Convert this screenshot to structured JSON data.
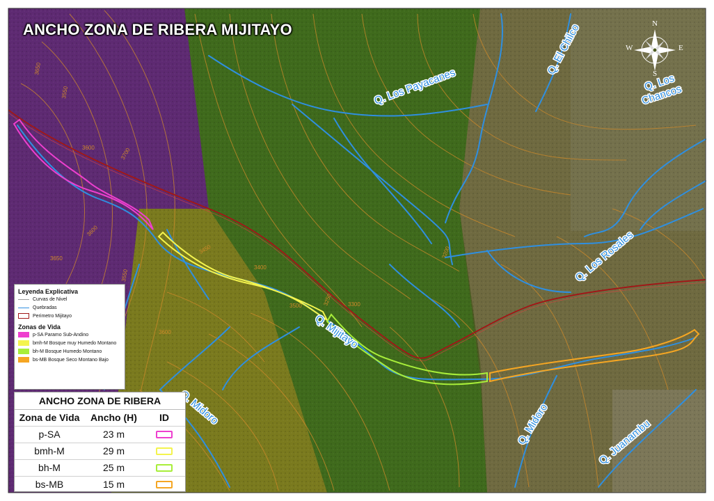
{
  "title": "ANCHO ZONA DE RIBERA MIJITAYO",
  "compass": {
    "n": "N",
    "s": "S",
    "e": "E",
    "w": "W"
  },
  "stream_labels": {
    "payacanes": "Q. Los Payacanes",
    "el_chilco": "Q. El Chilco",
    "los_chancos_1": "Q. Los",
    "los_chancos_2": "Chancos",
    "los_rosales": "Q. Los Rosales",
    "mijitayo": "Q. Mijitayo",
    "midoro_w": "Q. Midoro",
    "midoro_e": "Q. Midoro",
    "juanambu": "Q. Juanambu"
  },
  "contour_labels": {
    "c3650": "3650",
    "c3550": "3550",
    "c3600": "3600",
    "c3700": "3700",
    "c3600b": "3600",
    "c3650b": "3650",
    "c3550b": "3550",
    "c3400": "3400",
    "c3300": "3300",
    "c3250": "3250",
    "c3600c": "3600",
    "c3500": "3500",
    "c3450": "3450",
    "c3200": "3200"
  },
  "legend": {
    "title": "Leyenda Explicativa",
    "items": [
      {
        "label": "Curvas de Nivel",
        "color": "#9a9a9a"
      },
      {
        "label": "Quebradas",
        "color": "#2f8fe0"
      },
      {
        "label": "Perimetro Mijitayo",
        "color": "#a01818"
      }
    ],
    "zones_title": "Zonas de Vida",
    "zones": [
      {
        "label": "p-SA Paramo Sub-Andino",
        "color": "#ee3fcf"
      },
      {
        "label": "bmh-M Bosque muy Humedo Montano",
        "color": "#f4f44e"
      },
      {
        "label": "bh-M Bosque Humedo Montano",
        "color": "#a8ee3a"
      },
      {
        "label": "bs-MB Bosque Seco Montano Bajo",
        "color": "#f5a623"
      }
    ]
  },
  "table": {
    "title": "ANCHO ZONA DE RIBERA",
    "headers": [
      "Zona de Vida",
      "Ancho (H)",
      "ID"
    ],
    "rows": [
      {
        "zone": "p-SA",
        "width": "23 m",
        "color": "#ee3fcf"
      },
      {
        "zone": "bmh-M",
        "width": "29 m",
        "color": "#f4f44e"
      },
      {
        "zone": "bh-M",
        "width": "25 m",
        "color": "#a8ee3a"
      },
      {
        "zone": "bs-MB",
        "width": "15 m",
        "color": "#f5a623"
      }
    ]
  },
  "colors": {
    "zone_psa": "#5e2a72",
    "zone_bmh": "#7a7a1e",
    "zone_bh": "#3f6a1c",
    "zone_bs": "#6f6a40",
    "streams": "#2f8fe0",
    "contours": "#d08a2a",
    "perimeter": "#a01818"
  }
}
